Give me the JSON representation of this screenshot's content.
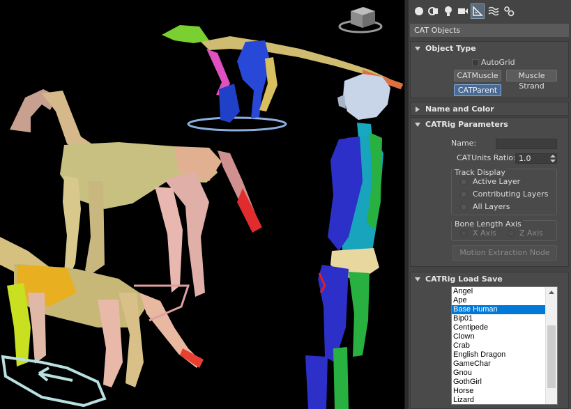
{
  "command_panel": {
    "tabs": [
      {
        "name": "create-geometry",
        "icon": "sphere-icon"
      },
      {
        "name": "create-shapes",
        "icon": "shapes-icon"
      },
      {
        "name": "create-lights",
        "icon": "light-icon"
      },
      {
        "name": "create-cameras",
        "icon": "camera-icon"
      },
      {
        "name": "create-helpers",
        "icon": "helpers-icon",
        "active": true
      },
      {
        "name": "create-spacewarps",
        "icon": "spacewarp-icon"
      },
      {
        "name": "create-systems",
        "icon": "systems-icon"
      }
    ],
    "category_dropdown": "CAT Objects",
    "object_type": {
      "header": "Object Type",
      "autogrid_label": "AutoGrid",
      "buttons": [
        "CATMuscle",
        "Muscle Strand",
        "CATParent"
      ],
      "selected_button": "CATParent"
    },
    "name_and_color": {
      "header": "Name and Color"
    },
    "catrig_parameters": {
      "header": "CATRig Parameters",
      "name_label": "Name:",
      "name_value": "",
      "units_ratio_label": "CATUnits Ratio:",
      "units_ratio_value": "1.0",
      "track_display": {
        "title": "Track Display",
        "options": [
          "Active Layer",
          "Contributing Layers",
          "All Layers"
        ]
      },
      "bone_length_axis": {
        "title": "Bone Length Axis",
        "options": [
          "X Axis",
          "Z Axis"
        ]
      },
      "motion_extraction_button": "Motion Extraction Node"
    },
    "catrig_load_save": {
      "header": "CATRig Load Save",
      "presets": [
        "Angel",
        "Ape",
        "Base Human",
        "Bip01",
        "Centipede",
        "Clown",
        "Crab",
        "English Dragon",
        "GameChar",
        "Gnou",
        "GothGirl",
        "Horse",
        "Lizard"
      ],
      "selected_preset": "Base Human"
    }
  },
  "viewport": {
    "viewcube_label": "",
    "colors": {
      "background": "#000000",
      "tan_bones": "#c8b878",
      "pink_bones": "#e0a8a0",
      "red_tail": "#e03030",
      "blue_body": "#2840d0",
      "cyan_body": "#20a8c0",
      "green_limb": "#30c030"
    }
  }
}
